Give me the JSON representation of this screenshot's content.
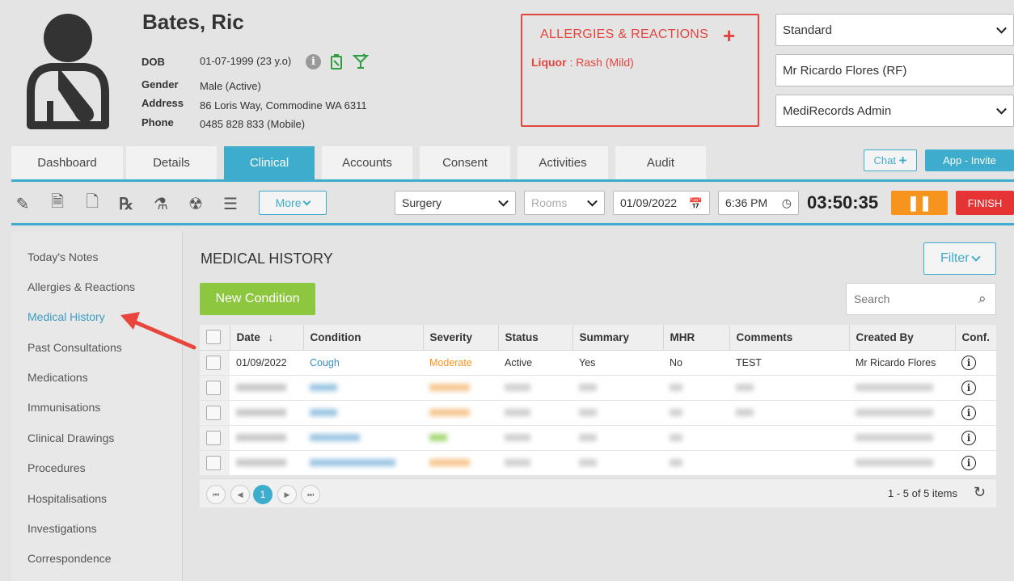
{
  "patient": {
    "name": "Bates, Ric",
    "dob_label": "DOB",
    "dob": "01-07-1999 (23 y.o)",
    "gender_label": "Gender",
    "gender": "Male (Active)",
    "address_label": "Address",
    "address": "86 Loris Way, Commodine WA 6311",
    "phone_label": "Phone",
    "phone": "0485 828 833 (Mobile)"
  },
  "allergies": {
    "title": "ALLERGIES & REACTIONS",
    "item_name": "Liquor",
    "item_reaction": ": Rash (Mild)"
  },
  "header_selects": {
    "billing": "Standard",
    "practitioner": "Mr Ricardo Flores (RF)",
    "role": "MediRecords Admin"
  },
  "tabs": [
    "Dashboard",
    "Details",
    "Clinical",
    "Accounts",
    "Consent",
    "Activities",
    "Audit"
  ],
  "active_tab": "Clinical",
  "chat_label": "Chat",
  "app_invite_label": "App - Invite",
  "toolbar": {
    "more_label": "More",
    "location": "Surgery",
    "rooms_placeholder": "Rooms",
    "date": "01/09/2022",
    "time": "6:36 PM",
    "timer": "03:50:35",
    "finish_label": "FINISH"
  },
  "sidebar": [
    "Today's Notes",
    "Allergies & Reactions",
    "Medical History",
    "Past Consultations",
    "Medications",
    "Immunisations",
    "Clinical Drawings",
    "Procedures",
    "Hospitalisations",
    "Investigations",
    "Correspondence"
  ],
  "active_sidebar": "Medical History",
  "main": {
    "title": "MEDICAL HISTORY",
    "filter_label": "Filter",
    "new_condition_label": "New Condition",
    "search_placeholder": "Search",
    "columns": [
      "Date",
      "Condition",
      "Severity",
      "Status",
      "Summary",
      "MHR",
      "Comments",
      "Created By",
      "Conf."
    ],
    "rows": [
      {
        "date": "01/09/2022",
        "condition": "Cough",
        "severity": "Moderate",
        "status": "Active",
        "summary": "Yes",
        "mhr": "No",
        "comments": "TEST",
        "created_by": "Mr Ricardo Flores"
      }
    ],
    "pager_page": "1",
    "pager_summary": "1 - 5 of 5 items"
  },
  "colors": {
    "accent": "#3eaccd",
    "allergy_red": "#e2463f",
    "green": "#8dc63f",
    "orange": "#f7941d",
    "finish_red": "#e63434",
    "severity_moderate": "#f7941d",
    "link_blue": "#3b8fc4"
  }
}
